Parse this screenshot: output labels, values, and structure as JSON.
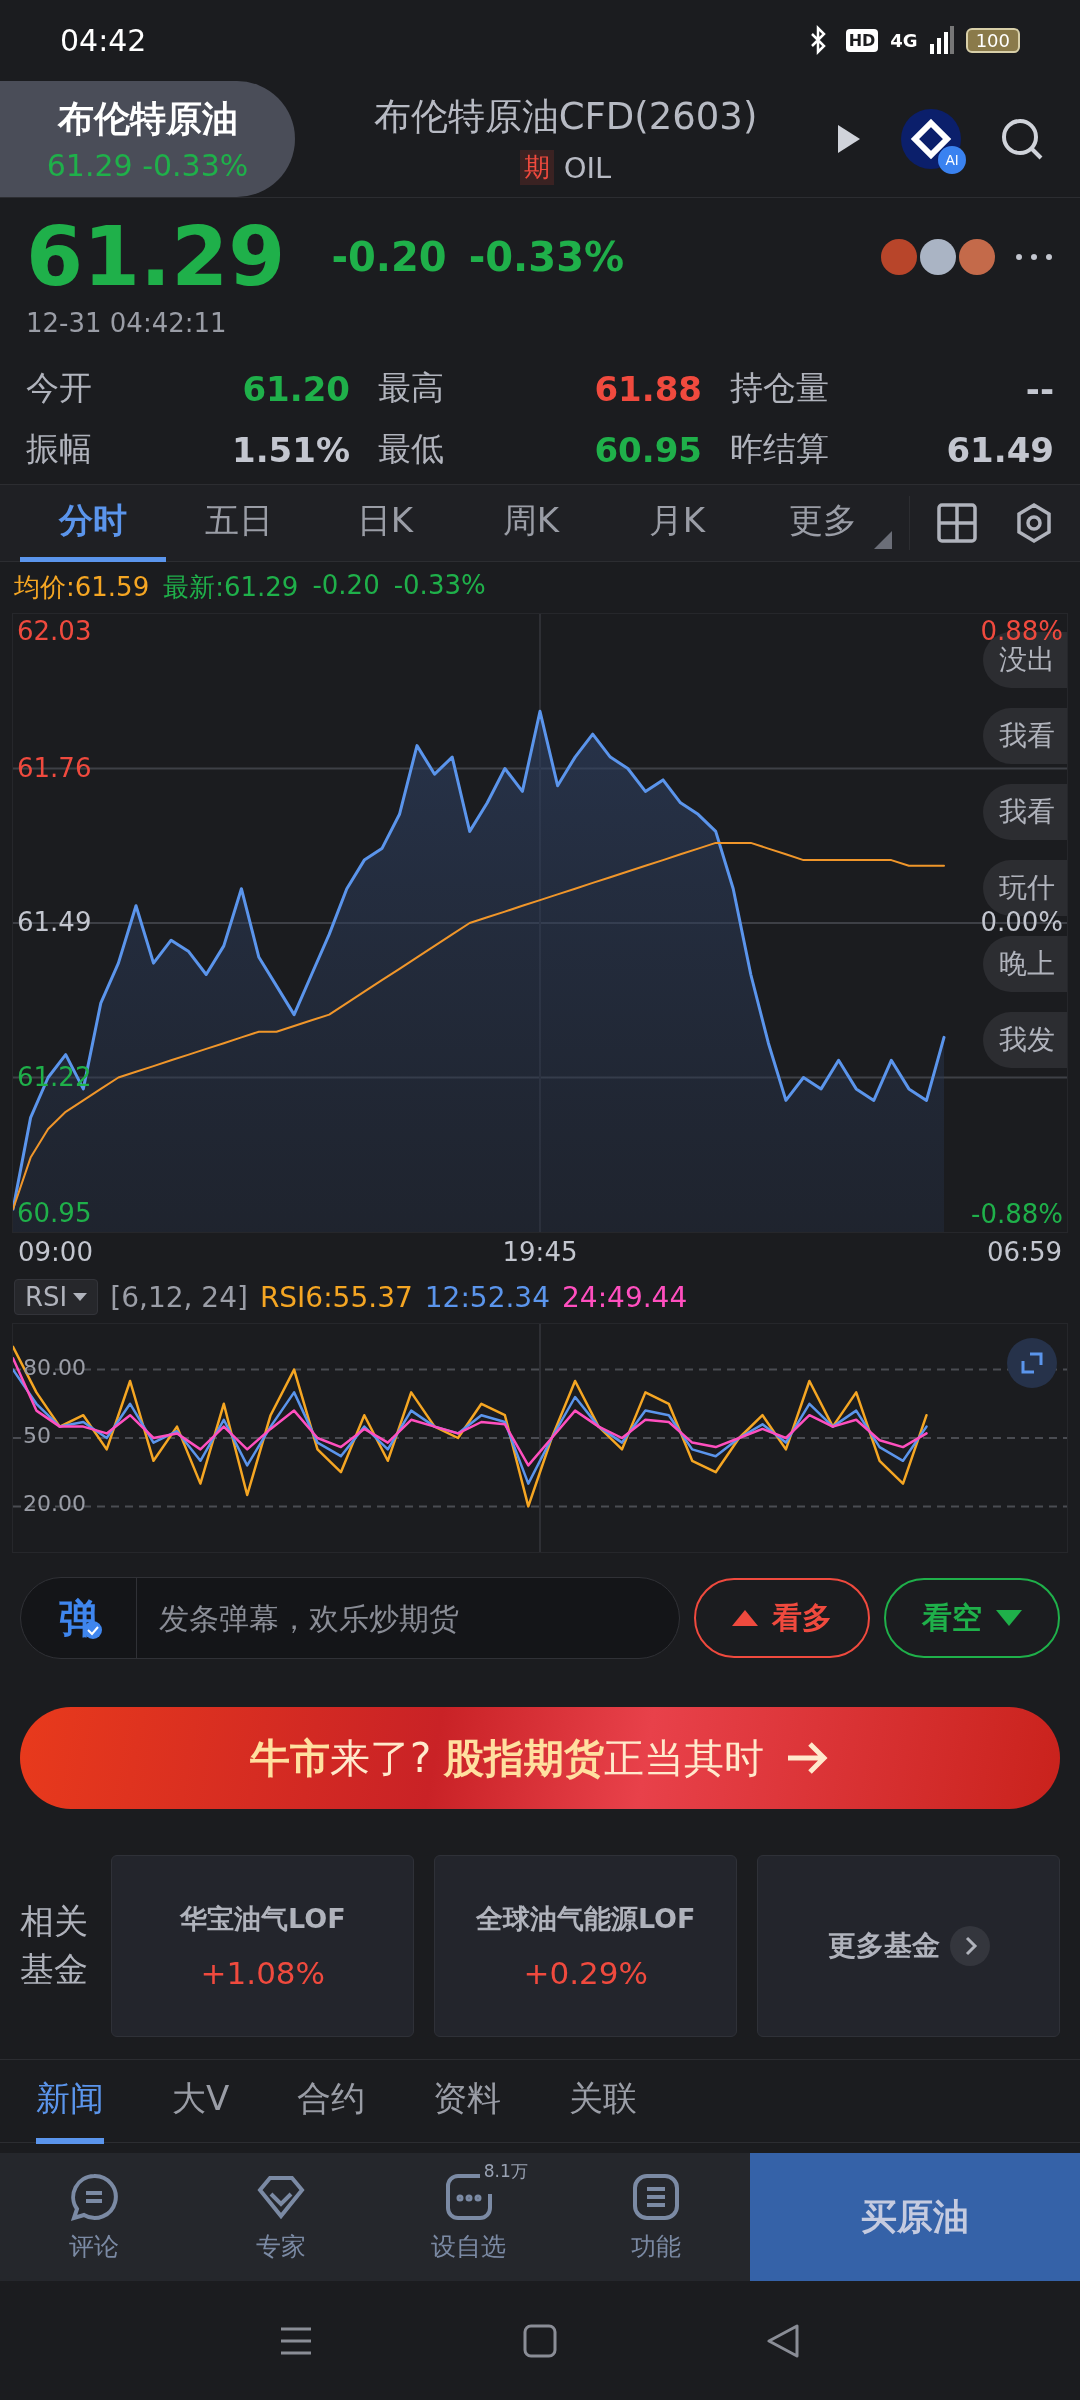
{
  "status_bar": {
    "time": "04:42",
    "hd": "HD",
    "network": "4G",
    "battery": "100"
  },
  "header": {
    "instrument_tab": {
      "name": "布伦特原油",
      "quote": "61.29 -0.33%",
      "selected": true
    },
    "title": "布伦特原油CFD(2603)",
    "badge": "期",
    "code": "OIL",
    "ai_badge": "AI"
  },
  "quote": {
    "price": "61.29",
    "change": "-0.20",
    "change_pct": "-0.33%",
    "time": "12-31 04:42:11"
  },
  "stats": [
    {
      "label": "今开",
      "value": "61.20",
      "color": "#1fb04a"
    },
    {
      "label": "最高",
      "value": "61.88",
      "color": "#f04a3e"
    },
    {
      "label": "持仓量",
      "value": "--",
      "color": "#c3c6cf"
    },
    {
      "label": "振幅",
      "value": "1.51%",
      "color": "#c3c6cf"
    },
    {
      "label": "最低",
      "value": "60.95",
      "color": "#1fb04a"
    },
    {
      "label": "昨结算",
      "value": "61.49",
      "color": "#c3c6cf"
    }
  ],
  "chart_tabs": [
    {
      "label": "分时",
      "selected": true,
      "menu": false
    },
    {
      "label": "五日",
      "selected": false,
      "menu": false
    },
    {
      "label": "日K",
      "selected": false,
      "menu": false
    },
    {
      "label": "周K",
      "selected": false,
      "menu": false
    },
    {
      "label": "月K",
      "selected": false,
      "menu": false
    },
    {
      "label": "更多",
      "selected": false,
      "menu": true
    }
  ],
  "legend": {
    "average": "均价:61.59",
    "latest": "最新:61.29",
    "change": "-0.20",
    "change_pct": "-0.33%"
  },
  "price_chart": {
    "right_labels": [
      {
        "label": "0.88%",
        "color": "#f04a3e"
      },
      {
        "label": "0.00%",
        "color": "#c3c6cf"
      },
      {
        "label": "-0.88%",
        "color": "#1fb04a"
      }
    ],
    "comments": [
      "没出",
      "我看",
      "我看",
      "玩什",
      "晚上",
      "我发"
    ],
    "time_labels": [
      "09:00",
      "19:45",
      "06:59"
    ],
    "chart_data": {
      "type": "line",
      "ylim": [
        60.95,
        62.03
      ],
      "yticks": [
        {
          "value": 62.03,
          "label": "62.03"
        },
        {
          "value": 61.76,
          "label": "61.76"
        },
        {
          "value": 61.49,
          "label": "61.49"
        },
        {
          "value": 61.22,
          "label": "61.22"
        },
        {
          "value": 60.95,
          "label": "60.95"
        }
      ],
      "grid": true,
      "series": [
        {
          "type": "area",
          "color": "#5b95ec",
          "values": [
            60.99,
            61.15,
            61.22,
            61.26,
            61.2,
            61.35,
            61.42,
            61.52,
            61.42,
            61.46,
            61.44,
            61.4,
            61.45,
            61.55,
            61.43,
            61.38,
            61.33,
            61.4,
            61.47,
            61.55,
            61.6,
            61.62,
            61.68,
            61.8,
            61.75,
            61.78,
            61.65,
            61.7,
            61.76,
            61.72,
            61.86,
            61.73,
            61.78,
            61.82,
            61.78,
            61.76,
            61.72,
            61.74,
            61.7,
            61.68,
            61.65,
            61.55,
            61.4,
            61.28,
            61.18,
            61.22,
            61.2,
            61.25,
            61.2,
            61.18,
            61.25,
            61.2,
            61.18,
            61.29
          ]
        },
        {
          "type": "line",
          "color": "#f0962a",
          "values": [
            60.99,
            61.08,
            61.13,
            61.16,
            61.18,
            61.2,
            61.22,
            61.23,
            61.24,
            61.25,
            61.26,
            61.27,
            61.28,
            61.29,
            61.3,
            61.3,
            61.31,
            61.32,
            61.33,
            61.35,
            61.37,
            61.39,
            61.41,
            61.43,
            61.45,
            61.47,
            61.49,
            61.5,
            61.51,
            61.52,
            61.53,
            61.54,
            61.55,
            61.56,
            61.57,
            61.58,
            61.59,
            61.6,
            61.61,
            61.62,
            61.63,
            61.63,
            61.63,
            61.62,
            61.61,
            61.6,
            61.6,
            61.6,
            61.6,
            61.6,
            61.6,
            61.59,
            61.59,
            61.59
          ]
        }
      ]
    }
  },
  "indicator": {
    "name": "RSI",
    "params": "[6,12, 24]",
    "readings": [
      {
        "label": "RSI6:55.37",
        "color": "#f5a623"
      },
      {
        "label": "12:52.34",
        "color": "#5b95ec"
      },
      {
        "label": "24:49.44",
        "color": "#ff4fbf"
      }
    ],
    "chart_data": {
      "type": "line",
      "ylim": [
        0,
        100
      ],
      "grid": true,
      "yticks": [
        {
          "value": 80,
          "label": "80.00"
        },
        {
          "value": 50,
          "label": "50"
        },
        {
          "value": 20,
          "label": "20.00"
        }
      ],
      "series": [
        {
          "color": "#f5a623",
          "values": [
            90,
            70,
            55,
            60,
            45,
            75,
            40,
            55,
            30,
            65,
            25,
            60,
            80,
            45,
            35,
            60,
            40,
            70,
            55,
            50,
            65,
            60,
            20,
            50,
            75,
            55,
            45,
            70,
            65,
            40,
            35,
            50,
            60,
            45,
            75,
            55,
            70,
            40,
            30,
            60
          ]
        },
        {
          "color": "#5b95ec",
          "values": [
            80,
            65,
            55,
            57,
            50,
            65,
            48,
            53,
            40,
            58,
            38,
            55,
            70,
            48,
            42,
            55,
            45,
            62,
            55,
            52,
            60,
            57,
            30,
            50,
            68,
            55,
            48,
            62,
            60,
            45,
            42,
            50,
            56,
            48,
            65,
            55,
            62,
            46,
            40,
            55
          ]
        },
        {
          "color": "#ff4fbf",
          "values": [
            85,
            62,
            55,
            55,
            52,
            60,
            50,
            52,
            45,
            55,
            45,
            54,
            62,
            50,
            46,
            54,
            48,
            58,
            55,
            52,
            57,
            56,
            38,
            50,
            62,
            55,
            50,
            58,
            57,
            48,
            46,
            50,
            54,
            50,
            60,
            55,
            58,
            49,
            46,
            52
          ]
        }
      ]
    }
  },
  "comment_bar": {
    "icon_text": "弹",
    "placeholder": "发条弹幕，欢乐炒期货",
    "votes": [
      {
        "label": "看多",
        "kind": "bull"
      },
      {
        "label": "看空",
        "kind": "bear"
      }
    ]
  },
  "banner": {
    "text": "**牛市**来了? **股指期货**正当其时"
  },
  "funds": {
    "label": "相关基金",
    "items": [
      {
        "name": "华宝油气LOF",
        "change": "+1.08%",
        "color": "#f04a3e"
      },
      {
        "name": "全球油气能源LOF",
        "change": "+0.29%",
        "color": "#f04a3e"
      }
    ],
    "more": "更多基金"
  },
  "news_tabs": [
    {
      "label": "新闻",
      "selected": true
    },
    {
      "label": "大V",
      "selected": false
    },
    {
      "label": "合约",
      "selected": false
    },
    {
      "label": "资料",
      "selected": false
    },
    {
      "label": "关联",
      "selected": false
    }
  ],
  "bottom_bar": {
    "actions": [
      {
        "label": "评论",
        "kind": "comment"
      },
      {
        "label": "专家",
        "kind": "expert"
      },
      {
        "label": "设自选",
        "kind": "watchlist",
        "badge": "8.1万"
      },
      {
        "label": "功能",
        "kind": "menu"
      }
    ],
    "buy": "买原油"
  }
}
